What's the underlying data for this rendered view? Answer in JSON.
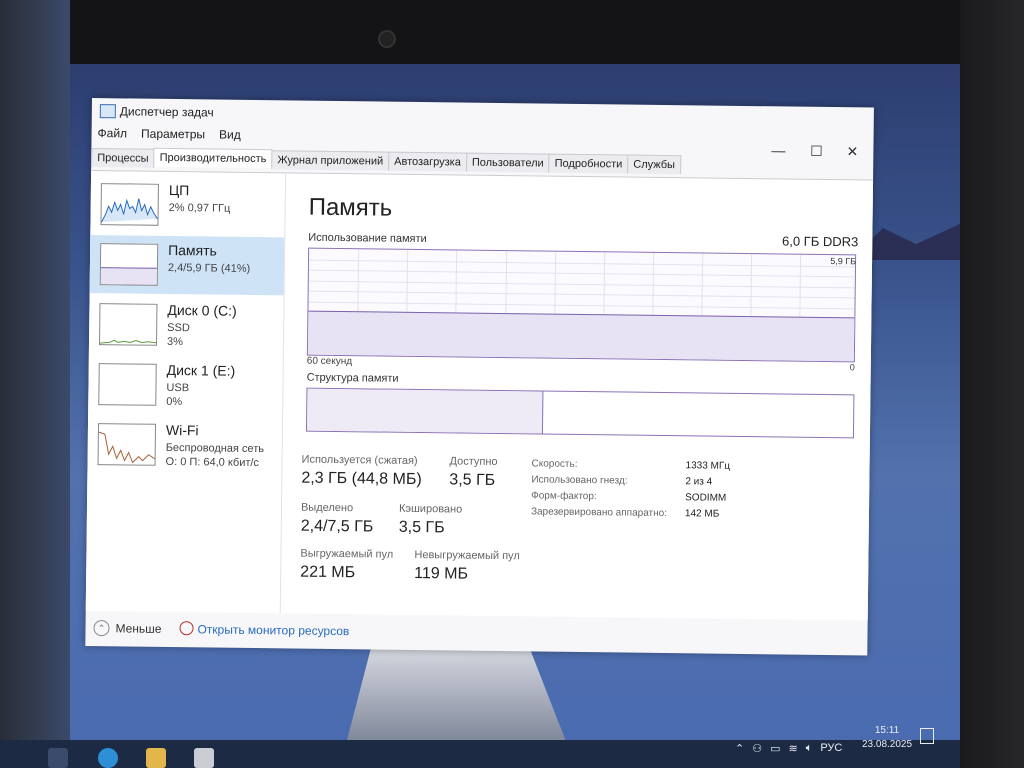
{
  "window": {
    "title": "Диспетчер задач",
    "menu": [
      "Файл",
      "Параметры",
      "Вид"
    ],
    "tabs": [
      "Процессы",
      "Производительность",
      "Журнал приложений",
      "Автозагрузка",
      "Пользователи",
      "Подробности",
      "Службы"
    ],
    "active_tab": "Производительность",
    "controls": {
      "minimize": "—",
      "maximize": "☐",
      "close": "✕"
    }
  },
  "sidebar": {
    "items": [
      {
        "name": "ЦП",
        "line2": "2% 0,97 ГГц",
        "line3": "",
        "icon": "cpu-graph"
      },
      {
        "name": "Память",
        "line2": "2,4/5,9 ГБ (41%)",
        "line3": "",
        "icon": "memory-graph"
      },
      {
        "name": "Диск 0 (C:)",
        "line2": "SSD",
        "line3": "3%",
        "icon": "disk-graph"
      },
      {
        "name": "Диск 1 (E:)",
        "line2": "USB",
        "line3": "0%",
        "icon": "disk-graph"
      },
      {
        "name": "Wi-Fi",
        "line2": "Беспроводная сеть",
        "line3": "О: 0 П: 64,0 кбит/с",
        "icon": "network-graph"
      }
    ],
    "selected": "Память"
  },
  "memory": {
    "title": "Память",
    "spec": "6,0 ГБ DDR3",
    "usage_label": "Использование памяти",
    "usage_max": "5,9 ГБ",
    "usage_fraction": 0.41,
    "seconds_label": "60 секунд",
    "zero_label": "0",
    "structure_label": "Структура памяти",
    "structure_in_use_fraction": 0.43,
    "stats": {
      "in_use_label": "Используется (сжатая)",
      "in_use_value": "2,3 ГБ (44,8 МБ)",
      "available_label": "Доступно",
      "available_value": "3,5 ГБ",
      "committed_label": "Выделено",
      "committed_value": "2,4/7,5 ГБ",
      "cached_label": "Кэшировано",
      "cached_value": "3,5 ГБ",
      "paged_label": "Выгружаемый пул",
      "paged_value": "221 МБ",
      "nonpaged_label": "Невыгружаемый пул",
      "nonpaged_value": "119 МБ"
    },
    "specs": [
      {
        "key": "Скорость:",
        "value": "1333 МГц"
      },
      {
        "key": "Использовано гнезд:",
        "value": "2 из 4"
      },
      {
        "key": "Форм-фактор:",
        "value": "SODIMM"
      },
      {
        "key": "Зарезервировано аппаратно:",
        "value": "142 МБ"
      }
    ]
  },
  "footer": {
    "less_label": "Меньше",
    "resource_monitor_label": "Открыть монитор ресурсов"
  },
  "taskbar": {
    "language": "РУС",
    "time": "15:11",
    "date": "23.08.2025"
  },
  "colors": {
    "memory_accent": "#7a62ac",
    "selection": "#cfe3f6",
    "link": "#2a6cc0",
    "cpu_line": "#2a6cc0",
    "disk_line": "#5a9e3a",
    "net_line": "#a8603a"
  }
}
